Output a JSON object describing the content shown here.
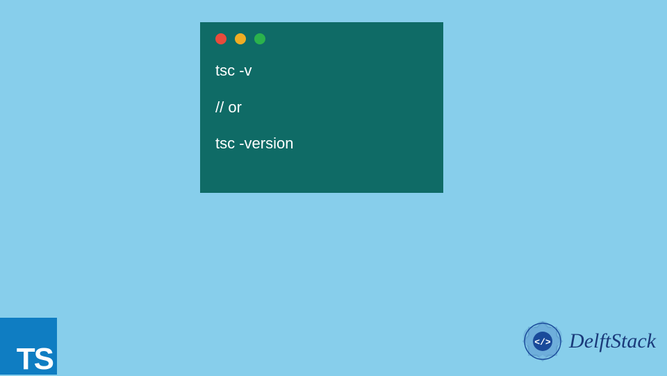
{
  "terminal": {
    "lines": [
      "tsc -v",
      "// or",
      "tsc -version"
    ],
    "dots": [
      "red",
      "yellow",
      "green"
    ]
  },
  "ts_badge": {
    "label": "TS"
  },
  "brand": {
    "name": "DelftStack",
    "logo_symbol": "</>",
    "logo_color": "#1a4a9a"
  }
}
